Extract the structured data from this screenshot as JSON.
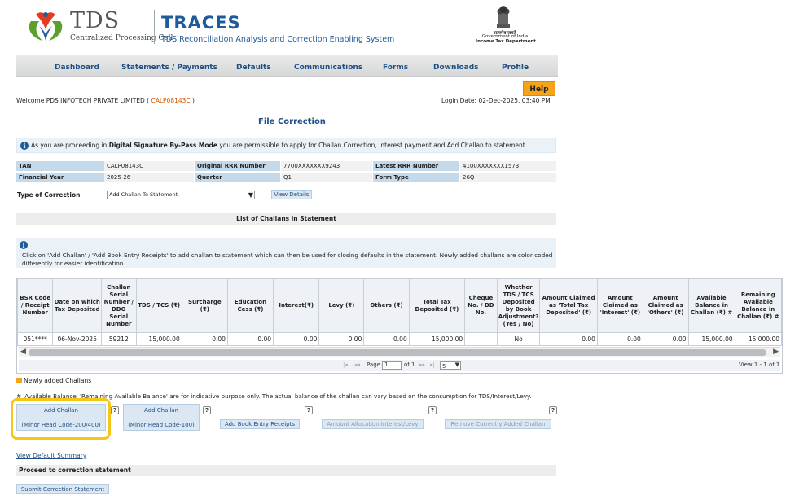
{
  "header": {
    "brand": "TDS",
    "brand_sub": "Centralized Processing Cell",
    "app_title": "TRACES",
    "app_sub": "TDS Reconciliation Analysis and Correction Enabling System",
    "gov_hindi": "सत्यमेव जयते",
    "gov_line1": "Government of India",
    "gov_line2": "Income Tax Department"
  },
  "nav": [
    "Dashboard",
    "Statements / Payments",
    "Defaults",
    "Communications",
    "Forms",
    "Downloads",
    "Profile"
  ],
  "help_label": "Help",
  "welcome_prefix": "Welcome PDS INFOTECH PRIVATE LIMITED (",
  "welcome_tan": "CALP08143C",
  "welcome_suffix": ")",
  "login_date": "Login Date: 02-Dec-2025, 03:40 PM",
  "page_title": "File Correction",
  "info_msg": {
    "pre": "As you are proceeding in ",
    "bold": "Digital Signature By-Pass Mode",
    "post": " you are permissible to apply for Challan Correction, Interest payment and Add Challan to statement."
  },
  "details": {
    "tan_label": "TAN",
    "tan_value": "CALP08143C",
    "orrr_label": "Original RRR Number",
    "orrr_value": "7700XXXXXXX9243",
    "lrrr_label": "Latest RRR Number",
    "lrrr_value": "4100XXXXXXX1573",
    "fy_label": "Financial Year",
    "fy_value": "2025-26",
    "quarter_label": "Quarter",
    "quarter_value": "Q1",
    "form_label": "Form Type",
    "form_value": "26Q"
  },
  "correction": {
    "label": "Type of Correction",
    "selected": "Add Challan To Statement",
    "view_button": "View Details"
  },
  "list_title": "List of Challans in Statement",
  "info2_text": "Click on 'Add Challan' / 'Add Book Entry Receipts' to add challan to statement which can then be used for closing defaults in the statement. Newly added challans are color coded differently for easier identification",
  "table": {
    "headers": [
      "BSR Code / Receipt Number",
      "Date on which Tax Deposited",
      "Challan Serial Number / DDO Serial Number",
      "TDS / TCS (₹)",
      "Surcharge (₹)",
      "Education Cess (₹)",
      "Interest(₹)",
      "Levy (₹)",
      "Others (₹)",
      "Total Tax Deposited (₹)",
      "Cheque No. / DD No.",
      "Whether TDS / TCS Deposited by Book Adjustment? (Yes / No)",
      "Amount Claimed as 'Total Tax Deposited' (₹)",
      "Amount Claimed as 'Interest' (₹)",
      "Amount Claimed as 'Others' (₹)",
      "Available Balance in Challan (₹) #",
      "Remaining Available Balance in Challan (₹) #"
    ],
    "row": [
      "051****",
      "06-Nov-2025",
      "59212",
      "15,000.00",
      "0.00",
      "0.00",
      "0.00",
      "0.00",
      "0.00",
      "15,000.00",
      "",
      "No",
      "0.00",
      "0.00",
      "0.00",
      "15,000.00",
      "15,000.00"
    ]
  },
  "pager": {
    "page_label": "Page",
    "page_value": "1",
    "of_label": "of 1",
    "rows_value": "5",
    "view_text": "View 1 - 1 of 1"
  },
  "legend_text": "Newly added Challans",
  "note_text": "# 'Available Balance' 'Remaining Available Balance' are for indicative purpose only. The actual balance of the challan can vary based on the consumption for TDS/Interest/Levy.",
  "buttons": {
    "add_challan_label": "Add Challan",
    "add_challan_1_sub": "(Minor Head Code-200/400)",
    "add_challan_2_sub": "(Minor Head Code-100)",
    "book_entry": "Add Book Entry Receipts",
    "allocation": "Amount Allocation Interest/Levy",
    "remove": "Remove Currently Added Challan",
    "help_q": "?"
  },
  "view_default": "View Default Summary",
  "proceed_title": "Proceed to correction statement",
  "submit_label": "Submit Correction Statement",
  "colors": {
    "accent": "#1f4f84",
    "help": "#f4a31b",
    "highlight": "#f5c518"
  }
}
